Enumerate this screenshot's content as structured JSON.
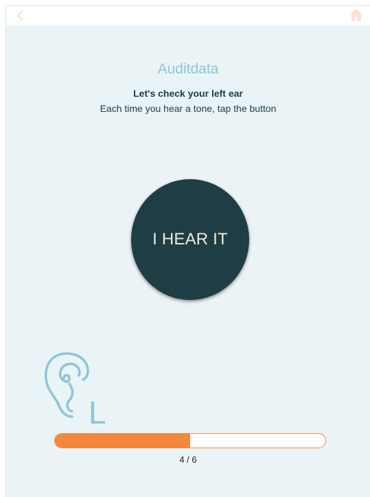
{
  "header": {
    "back_icon": "chevron-left-icon",
    "home_icon": "home-icon",
    "icon_color": "#fbe2d6"
  },
  "main": {
    "brand": "Auditdata",
    "title": "Let's check your left ear",
    "subtitle": "Each time you hear a tone, tap the button",
    "button_label": "I HEAR IT"
  },
  "ear_indicator": {
    "icon": "ear-icon",
    "side_label": "L",
    "color": "#8cc6d6"
  },
  "progress": {
    "current": 4,
    "total": 6,
    "fraction": 0.5,
    "label": "4 / 6",
    "fill_color": "#f3873d"
  },
  "colors": {
    "background": "#eaf3f6",
    "button": "#1f3d44",
    "button_text": "#f5ead8",
    "accent": "#8cc6d6"
  }
}
